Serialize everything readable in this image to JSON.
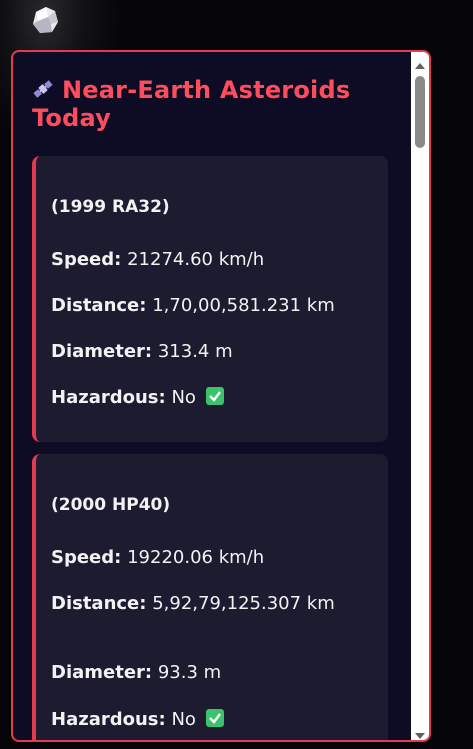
{
  "app": {
    "logo_icon": "asteroid-rock-icon"
  },
  "panel": {
    "title": "Near-Earth Asteroids Today",
    "title_icon": "satellite-icon",
    "accent_color": "#e23a4e"
  },
  "asteroids": [
    {
      "name": "(1999 RA32)",
      "speed_label": "Speed:",
      "speed_value": "21274.60 km/h",
      "distance_label": "Distance:",
      "distance_value": "1,70,00,581.231 km",
      "diameter_label": "Diameter:",
      "diameter_value": "313.4 m",
      "hazardous_label": "Hazardous:",
      "hazardous_value": "No",
      "hazardous_icon": "check-mark-icon"
    },
    {
      "name": "(2000 HP40)",
      "speed_label": "Speed:",
      "speed_value": "19220.06 km/h",
      "distance_label": "Distance:",
      "distance_value": "5,92,79,125.307 km",
      "diameter_label": "Diameter:",
      "diameter_value": "93.3 m",
      "hazardous_label": "Hazardous:",
      "hazardous_value": "No",
      "hazardous_icon": "check-mark-icon"
    }
  ]
}
